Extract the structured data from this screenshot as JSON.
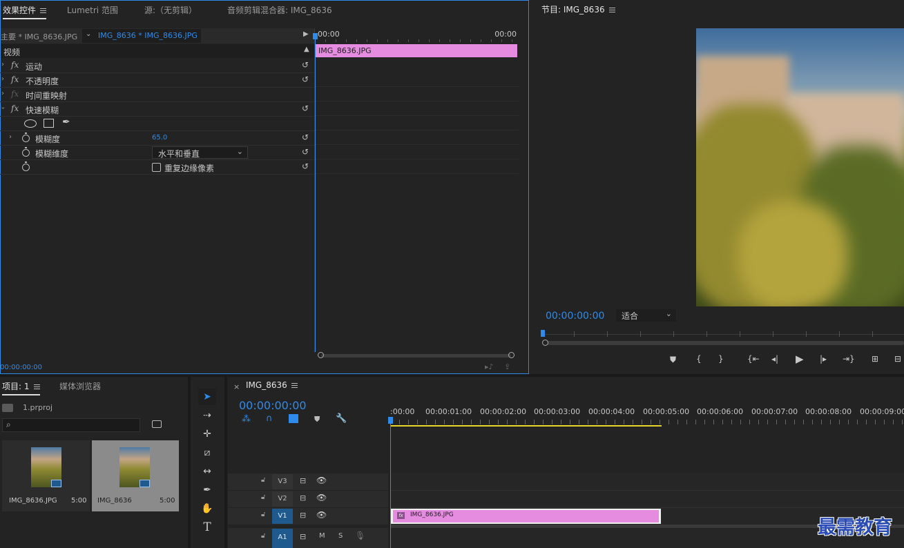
{
  "effect_controls": {
    "tabs": [
      "效果控件",
      "Lumetri 范围",
      "源:（无剪辑）",
      "音频剪辑混合器: IMG_8636"
    ],
    "master_label": "主要 * IMG_8636.JPG",
    "clip_label": "IMG_8636 * IMG_8636.JPG",
    "section": "视频",
    "effects": [
      {
        "label": "运动",
        "expanded": false
      },
      {
        "label": "不透明度",
        "expanded": false
      },
      {
        "label": "时间重映射",
        "expanded": false
      },
      {
        "label": "快速模糊",
        "expanded": true
      }
    ],
    "blur_amount_label": "模糊度",
    "blur_amount_value": "65.0",
    "blur_dim_label": "模糊维度",
    "blur_dim_value": "水平和垂直",
    "repeat_edge_label": "重复边缘像素",
    "timeline_start": "00:00",
    "timeline_end": "00:00",
    "clip_name": "IMG_8636.JPG",
    "timecode": "00:00:00:00"
  },
  "program_monitor": {
    "title": "节目: IMG_8636",
    "timecode": "00:00:00:00",
    "fit_label": "适合"
  },
  "project": {
    "tabs": [
      "项目: 1",
      "媒体浏览器"
    ],
    "file": "1.prproj",
    "search_placeholder": "",
    "items": [
      {
        "name": "IMG_8636.JPG",
        "duration": "5:00"
      },
      {
        "name": "IMG_8636",
        "duration": "5:00"
      }
    ]
  },
  "timeline": {
    "title": "IMG_8636",
    "timecode": "00:00:00:00",
    "ruler": [
      ":00:00",
      "00:00:01:00",
      "00:00:02:00",
      "00:00:03:00",
      "00:00:04:00",
      "00:00:05:00",
      "00:00:06:00",
      "00:00:07:00",
      "00:00:08:00",
      "00:00:09:00"
    ],
    "tracks": [
      "V3",
      "V2",
      "V1",
      "A1"
    ],
    "audio_mute": "M",
    "audio_solo": "S",
    "clip_name": "IMG_8636.JPG"
  },
  "watermark": "最需教育",
  "colors": {
    "accent": "#2d8ceb",
    "clip": "#e58be0",
    "work_area": "#e8d52a"
  }
}
